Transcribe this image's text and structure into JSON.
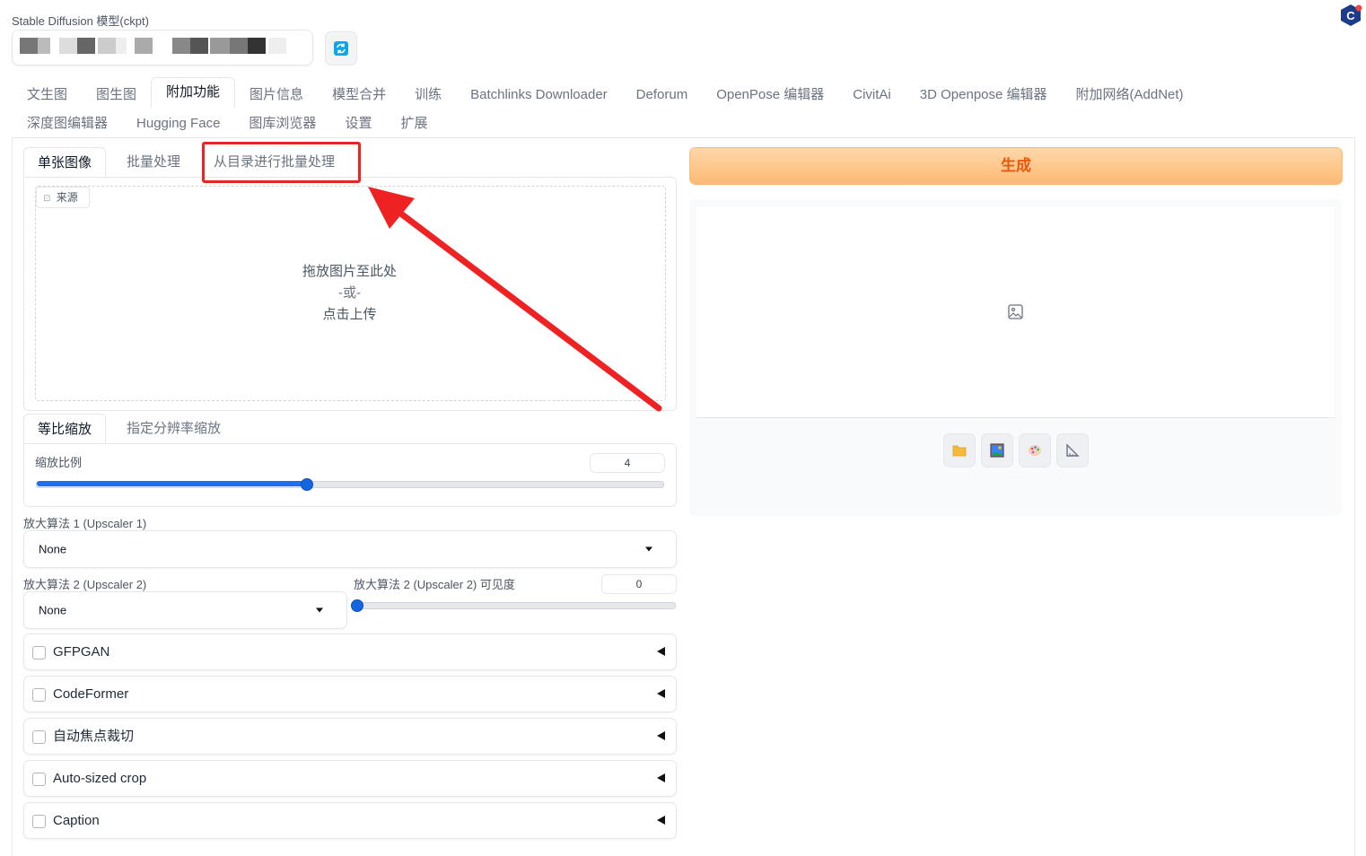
{
  "header": {
    "model_label": "Stable Diffusion 模型(ckpt)",
    "refresh_icon": "refresh-icon",
    "brand_icon": "c-logo-icon"
  },
  "main_tabs": [
    {
      "label": "文生图"
    },
    {
      "label": "图生图"
    },
    {
      "label": "附加功能",
      "active": true
    },
    {
      "label": "图片信息"
    },
    {
      "label": "模型合并"
    },
    {
      "label": "训练"
    },
    {
      "label": "Batchlinks Downloader"
    },
    {
      "label": "Deforum"
    },
    {
      "label": "OpenPose 编辑器"
    },
    {
      "label": "CivitAi"
    },
    {
      "label": "3D Openpose 编辑器"
    },
    {
      "label": "附加网络(AddNet)"
    },
    {
      "label": "深度图编辑器"
    },
    {
      "label": "Hugging Face"
    },
    {
      "label": "图库浏览器"
    },
    {
      "label": "设置"
    },
    {
      "label": "扩展"
    }
  ],
  "left": {
    "image_tabs": [
      {
        "label": "单张图像",
        "active": true
      },
      {
        "label": "批量处理"
      },
      {
        "label": "从目录进行批量处理",
        "highlighted": true
      }
    ],
    "source_label": "来源",
    "drop": {
      "line1": "拖放图片至此处",
      "line2": "-或-",
      "line3": "点击上传"
    },
    "resize_tabs": [
      {
        "label": "等比缩放",
        "active": true
      },
      {
        "label": "指定分辨率缩放"
      }
    ],
    "scale": {
      "label": "缩放比例",
      "value": "4",
      "fraction": 0.43
    },
    "upscaler1": {
      "label": "放大算法 1 (Upscaler 1)",
      "value": "None"
    },
    "upscaler2": {
      "label": "放大算法 2 (Upscaler 2)",
      "value": "None"
    },
    "upscaler2_visibility": {
      "label": "放大算法 2 (Upscaler 2) 可见度",
      "value": "0",
      "fraction": 0.0
    },
    "accordions": [
      {
        "label": "GFPGAN"
      },
      {
        "label": "CodeFormer"
      },
      {
        "label": "自动焦点裁切"
      },
      {
        "label": "Auto-sized crop"
      },
      {
        "label": "Caption"
      }
    ]
  },
  "right": {
    "generate_label": "生成",
    "image_placeholder_icon": "image-icon",
    "tools": [
      {
        "icon": "folder-icon"
      },
      {
        "icon": "send-to-img2img-icon"
      },
      {
        "icon": "send-to-inpaint-icon"
      },
      {
        "icon": "send-to-extras-icon"
      }
    ]
  },
  "annotation": {
    "color": "#ee2222",
    "shape": "arrow-and-box"
  }
}
